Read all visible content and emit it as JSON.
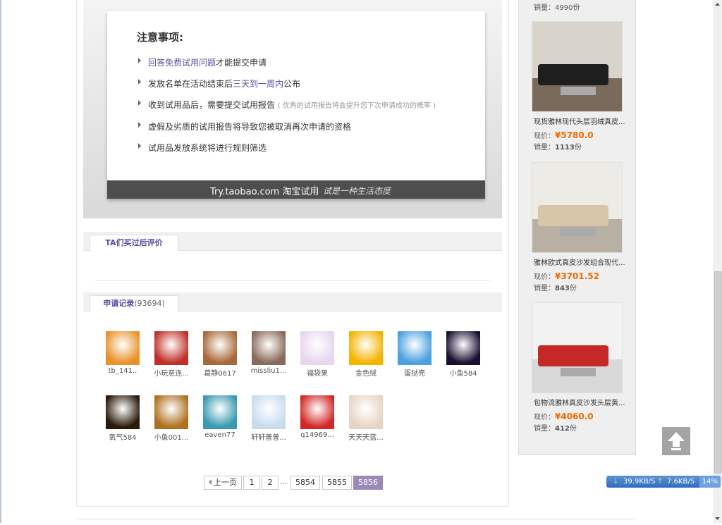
{
  "notice": {
    "title": "注意事项:",
    "rule1_link": "回答免费试用问题",
    "rule1_rest": "才能提交申请",
    "rule2_pre": "发放名单在活动结束后",
    "rule2_hl": "三天到一周内",
    "rule2_post": "公布",
    "rule3": "收到试用品后，需要提交试用报告",
    "rule3_note": "( 优秀的试用报告将会提升您下次申请成功的概率 )",
    "rule4": "虚假及劣质的试用报告将导致您被取消再次申请的资格",
    "rule5": "试用品发放系统将进行规则筛选",
    "footer_brand": "Try.taobao.com 淘宝试用",
    "footer_slogan": "试是一种生活态度"
  },
  "tabs": {
    "reviews_label": "TA们买过后评价",
    "records_label": "申请记录",
    "records_count": "(93694)"
  },
  "users": [
    {
      "name": "tb_141..",
      "color": "#e8932a",
      "icon": "duck-avatar"
    },
    {
      "name": "小玩意连...",
      "color": "#c0302a",
      "icon": "badge-avatar"
    },
    {
      "name": "葛静0617",
      "color": "#a8693a",
      "icon": "face-avatar"
    },
    {
      "name": "missliu1...",
      "color": "#8a6a5a",
      "icon": "girl-avatar"
    },
    {
      "name": "福袋果",
      "color": "#e6d6ee",
      "icon": "anime-avatar"
    },
    {
      "name": "金色绒",
      "color": "#f4b400",
      "icon": "cartoon-avatar"
    },
    {
      "name": "蛋挞壳",
      "color": "#4aa0e0",
      "icon": "heart-sky-avatar"
    },
    {
      "name": "小鱼584",
      "color": "#1a1030",
      "icon": "night-avatar"
    },
    {
      "name": "氧气584",
      "color": "#2a1a0a",
      "icon": "lights-avatar"
    },
    {
      "name": "小鱼001...",
      "color": "#b07020",
      "icon": "autumn-avatar"
    },
    {
      "name": "eaven77",
      "color": "#3a9ab0",
      "icon": "sea-avatar"
    },
    {
      "name": "轩轩普普...",
      "color": "#c8dcf0",
      "icon": "winter-avatar"
    },
    {
      "name": "q14969...",
      "color": "#d42828",
      "icon": "fox-avatar"
    },
    {
      "name": "天天天蓝...",
      "color": "#e8d4c4",
      "icon": "portrait-avatar"
    }
  ],
  "pagination": {
    "prev": "上一页",
    "p1": "1",
    "p2": "2",
    "dots": "...",
    "p5854": "5854",
    "p5855": "5855",
    "p5856": "5856"
  },
  "sidebar": {
    "top_sales": "销量：4990份",
    "price_label": "现价：",
    "sales_label": "销量：",
    "sales_unit": "份",
    "products": [
      {
        "name": "现货雅林现代头层羽绒真皮...",
        "price": "¥5780.0",
        "sales": "1113",
        "floor": "#7a6a5a",
        "sofa": "#1e1e1e",
        "wall": "#d8d4cc"
      },
      {
        "name": "雅林欧式真皮沙发组合现代...",
        "price": "¥3701.52",
        "sales": "843",
        "floor": "#b8b0a4",
        "sofa": "#d8c6a8",
        "wall": "#ecebe6"
      },
      {
        "name": "包物流雅林真皮沙发头层黄...",
        "price": "¥4060.0",
        "sales": "412",
        "floor": "#d8d8d8",
        "sofa": "#c62828",
        "wall": "#f2f2f2"
      }
    ]
  },
  "net_widget": {
    "down": "39.9KB/S",
    "up": "7.6KB/S",
    "percent": "14%"
  }
}
